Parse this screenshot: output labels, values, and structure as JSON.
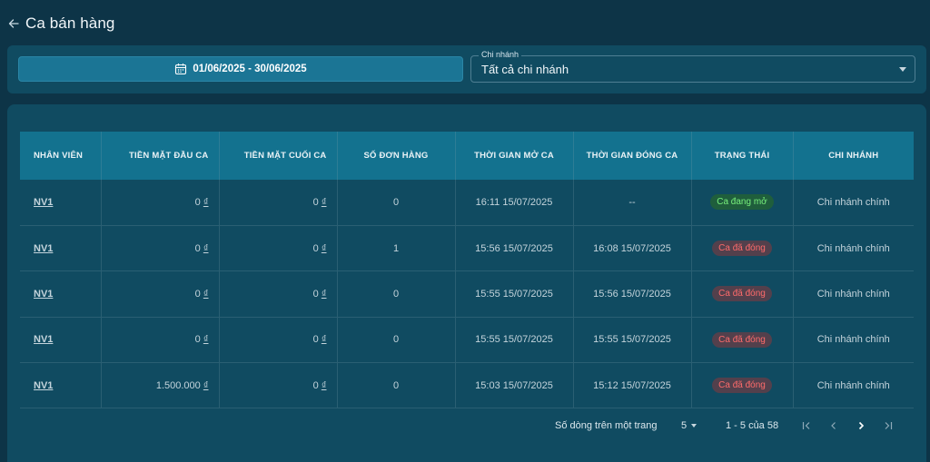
{
  "header": {
    "title": "Ca bán hàng"
  },
  "filters": {
    "date_range": "01/06/2025 - 30/06/2025",
    "branch_label": "Chi nhánh",
    "branch_value": "Tất cả chi nhánh"
  },
  "table": {
    "columns": [
      "NHÂN VIÊN",
      "TIỀN MẶT ĐẦU CA",
      "TIỀN MẶT CUỐI CA",
      "SỐ ĐƠN HÀNG",
      "THỜI GIAN MỞ CA",
      "THỜI GIAN ĐÓNG CA",
      "TRẠNG THÁI",
      "CHI NHÁNH"
    ],
    "rows": [
      {
        "staff": "NV1",
        "cash_start": "0",
        "cash_end": "0",
        "orders": "0",
        "open_time": "16:11 15/07/2025",
        "close_time": "--",
        "status": "Ca đang mở",
        "status_type": "open",
        "branch": "Chi nhánh chính"
      },
      {
        "staff": "NV1",
        "cash_start": "0",
        "cash_end": "0",
        "orders": "1",
        "open_time": "15:56 15/07/2025",
        "close_time": "16:08 15/07/2025",
        "status": "Ca đã đóng",
        "status_type": "closed",
        "branch": "Chi nhánh chính"
      },
      {
        "staff": "NV1",
        "cash_start": "0",
        "cash_end": "0",
        "orders": "0",
        "open_time": "15:55 15/07/2025",
        "close_time": "15:56 15/07/2025",
        "status": "Ca đã đóng",
        "status_type": "closed",
        "branch": "Chi nhánh chính"
      },
      {
        "staff": "NV1",
        "cash_start": "0",
        "cash_end": "0",
        "orders": "0",
        "open_time": "15:55 15/07/2025",
        "close_time": "15:55 15/07/2025",
        "status": "Ca đã đóng",
        "status_type": "closed",
        "branch": "Chi nhánh chính"
      },
      {
        "staff": "NV1",
        "cash_start": "1.500.000",
        "cash_end": "0",
        "orders": "0",
        "open_time": "15:03 15/07/2025",
        "close_time": "15:12 15/07/2025",
        "status": "Ca đã đóng",
        "status_type": "closed",
        "branch": "Chi nhánh chính"
      }
    ],
    "currency_symbol": "₫"
  },
  "pagination": {
    "rows_per_page_label": "Số dòng trên một trang",
    "rows_per_page_value": "5",
    "range_text": "1 - 5 của 58"
  },
  "colors": {
    "background": "#0d3447",
    "card": "#104b61",
    "table_header": "#13728f",
    "date_button": "#1b7595",
    "status_open_text": "#78f07c",
    "status_closed_text": "#ff6b6b"
  },
  "icons": {
    "back": "arrow-left-icon",
    "calendar": "calendar-icon",
    "branch_dropdown": "caret-down-icon",
    "rows_dropdown": "caret-down-icon",
    "first_page": "first-page-icon",
    "prev_page": "chevron-left-icon",
    "next_page": "chevron-right-icon",
    "last_page": "last-page-icon"
  }
}
